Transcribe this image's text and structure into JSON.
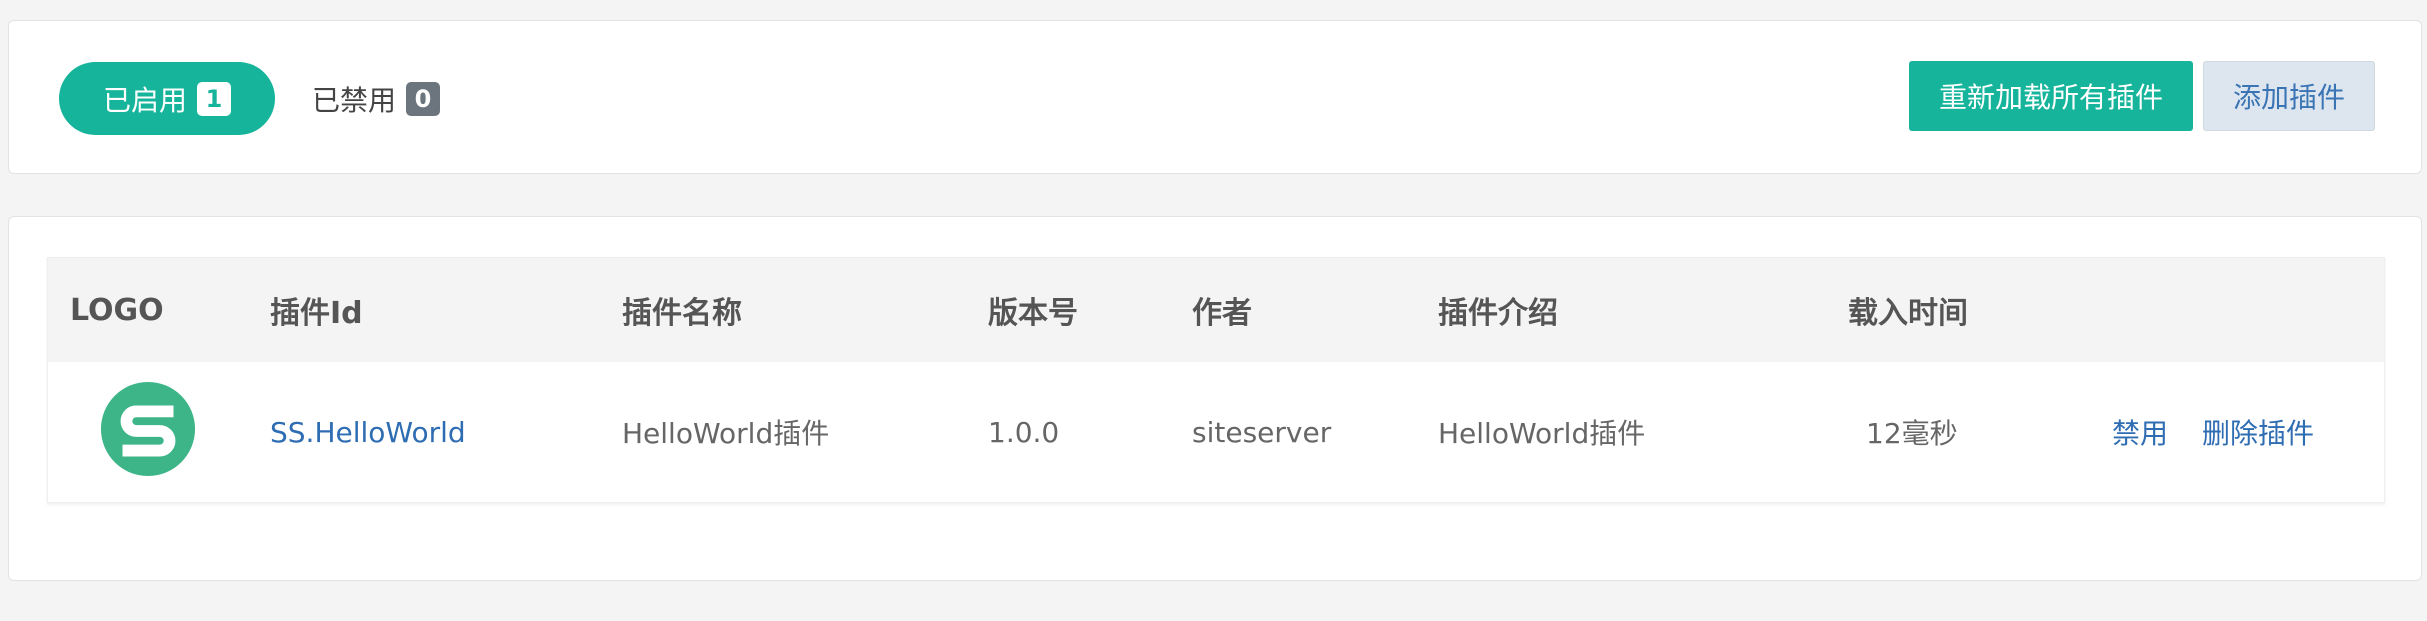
{
  "tabs": {
    "enabled_label": "已启用",
    "enabled_count": "1",
    "disabled_label": "已禁用",
    "disabled_count": "0"
  },
  "toolbar": {
    "reload_label": "重新加载所有插件",
    "add_label": "添加插件"
  },
  "table": {
    "headers": {
      "logo": "LOGO",
      "id": "插件Id",
      "name": "插件名称",
      "version": "版本号",
      "author": "作者",
      "description": "插件介绍",
      "load_time": "载入时间"
    },
    "rows": [
      {
        "logo_icon": "siteserver-logo-icon",
        "id": "SS.HelloWorld",
        "name": "HelloWorld插件",
        "version": "1.0.0",
        "author": "siteserver",
        "description": "HelloWorld插件",
        "load_time": "12毫秒",
        "disable_action": "禁用",
        "delete_action": "删除插件"
      }
    ]
  },
  "colors": {
    "accent": "#16b49b",
    "link": "#2f6db3",
    "logo_green": "#3db588"
  }
}
